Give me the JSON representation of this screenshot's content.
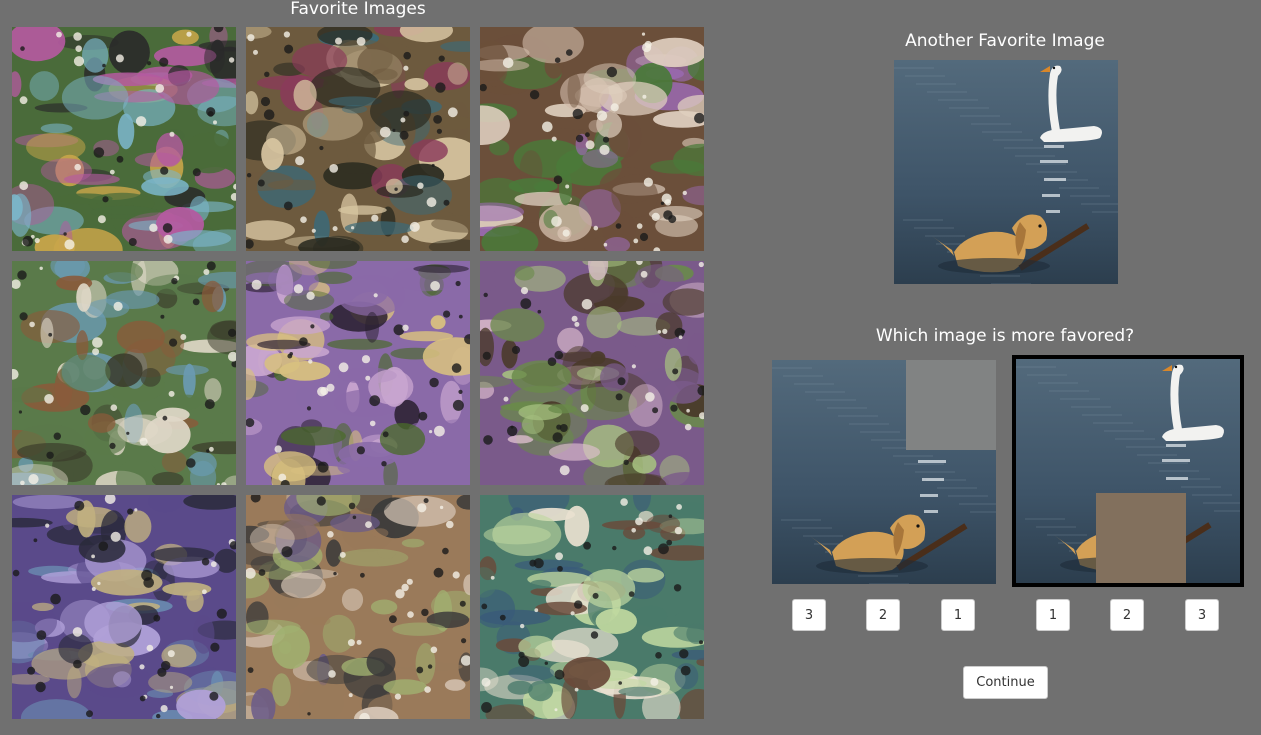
{
  "left_panel": {
    "title": "Favorite Images",
    "tiles": [
      {
        "name": "ant-waterbird-collage",
        "palette": [
          "#4a6b3a",
          "#c9a64a",
          "#2a2a2a",
          "#7bb5c9",
          "#b45aa0"
        ]
      },
      {
        "name": "ibis-collage",
        "palette": [
          "#6d5a3e",
          "#d8c6a2",
          "#8a3a5a",
          "#3a6a7a",
          "#2a2a20"
        ]
      },
      {
        "name": "spherical-bird-collage",
        "palette": [
          "#6b4f3a",
          "#d0b9a8",
          "#9a6ab0",
          "#4a7a3a",
          "#e0d0c0"
        ]
      },
      {
        "name": "heron-collage",
        "palette": [
          "#5a7a4a",
          "#e0d8c8",
          "#8a5a3a",
          "#6a9ab0",
          "#3a3a2a"
        ]
      },
      {
        "name": "purple-bird-collage",
        "palette": [
          "#8a6aa8",
          "#c9a6d0",
          "#4a6a2a",
          "#d8c080",
          "#2a2030"
        ]
      },
      {
        "name": "flamingo-collage",
        "palette": [
          "#7a5a8a",
          "#a6c080",
          "#4a3a2a",
          "#e0c0d0",
          "#6a8a4a"
        ]
      },
      {
        "name": "swirl-collage",
        "palette": [
          "#5a4a8a",
          "#b0a0d8",
          "#2a2a3a",
          "#c0b080",
          "#6a8ab0"
        ]
      },
      {
        "name": "speckled-bird-collage",
        "palette": [
          "#9a7a5a",
          "#d8c8b8",
          "#6a5a8a",
          "#3a3a3a",
          "#a0b070"
        ]
      },
      {
        "name": "wading-bird-collage",
        "palette": [
          "#4a7a6a",
          "#c0d8a0",
          "#6a4a3a",
          "#e8e0d0",
          "#3a5a7a"
        ]
      }
    ]
  },
  "right_panel": {
    "title": "Another Favorite Image",
    "question": "Which image is more favored?",
    "option_a_occluder_color": "#818383",
    "option_b_occluder_color": "#82705d",
    "option_a_buttons": [
      "3",
      "2",
      "1"
    ],
    "option_b_buttons": [
      "1",
      "2",
      "3"
    ],
    "continue_label": "Continue"
  },
  "colors": {
    "background": "#707070",
    "water": "#3e5468",
    "swan": "#f2f2f0",
    "dog": "#d3a056"
  }
}
